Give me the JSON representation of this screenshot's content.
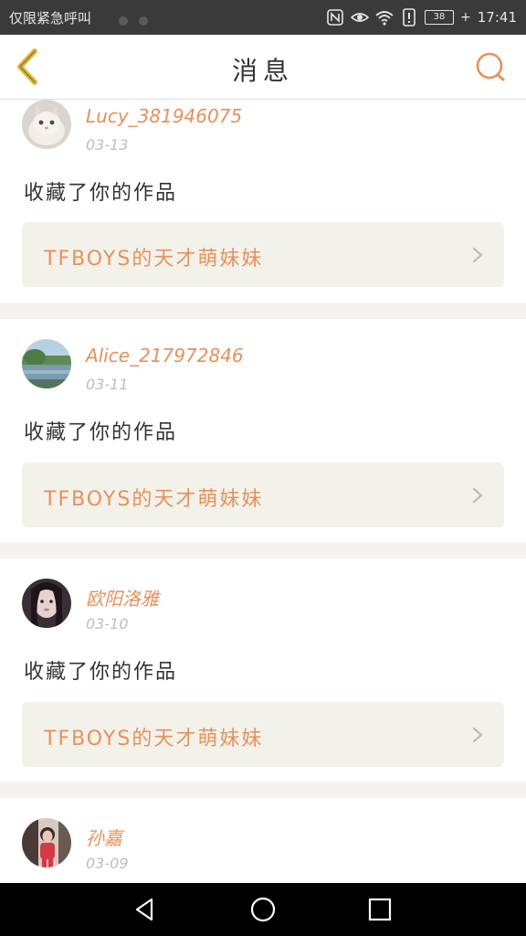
{
  "status_bar": {
    "carrier_text": "仅限紧急呼叫",
    "icons": [
      "nfc-icon",
      "eye-icon",
      "wifi-icon",
      "alert-icon",
      "battery-icon"
    ],
    "battery_level": "38",
    "time": "17:41"
  },
  "header": {
    "title": "消息",
    "back_icon": "chevron-left-icon",
    "search_icon": "search-icon"
  },
  "messages": [
    {
      "username": "Lucy_381946075",
      "date": "03-13",
      "action": "收藏了你的作品",
      "work_title": "TFBOYS的天才萌妹妹"
    },
    {
      "username": "Alice_217972846",
      "date": "03-11",
      "action": "收藏了你的作品",
      "work_title": "TFBOYS的天才萌妹妹"
    },
    {
      "username": "欧阳洛雅",
      "date": "03-10",
      "action": "收藏了你的作品",
      "work_title": "TFBOYS的天才萌妹妹"
    },
    {
      "username": "孙嘉",
      "date": "03-09"
    }
  ],
  "nav_bar": {
    "buttons": [
      "back-triangle-icon",
      "home-circle-icon",
      "recents-square-icon"
    ]
  },
  "colors": {
    "accent": "#e8905a",
    "back_arrow": "#e0b83a",
    "card_bg": "#f3f2ea",
    "divider": "#f4f3f1"
  }
}
